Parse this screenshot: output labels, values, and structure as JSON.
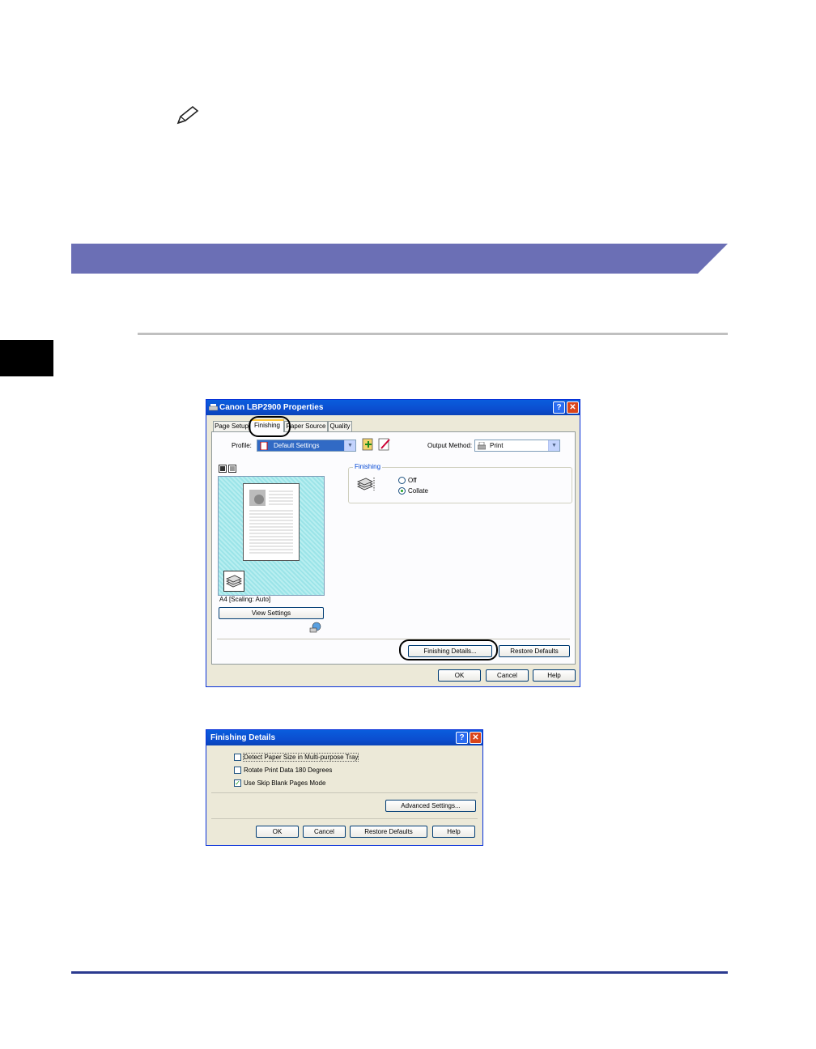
{
  "colors": {
    "banner": "#6b6fb5",
    "footer_rule": "#2b3a8f",
    "dialog_face": "#ece9d8",
    "titlebar": "#0b4ed0",
    "preview_bg": "#9be4e8"
  },
  "icons": [
    "pencil-note-icon",
    "printer-icon",
    "profile-icon",
    "finishing-stack-icon",
    "view-options-icon"
  ],
  "properties_dialog": {
    "title": "Canon LBP2900 Properties",
    "help_btn": "?",
    "close_btn": "✕",
    "tabs": [
      "Page Setup",
      "Finishing",
      "Paper Source",
      "Quality"
    ],
    "active_tab": "Finishing",
    "profile_label": "Profile:",
    "profile_value": "Default Settings",
    "output_method_label": "Output Method:",
    "output_method_value": "Print",
    "preview_caption": "A4 [Scaling: Auto]",
    "view_settings_btn": "View Settings",
    "finishing_group": "Finishing",
    "finishing_options": [
      "Off",
      "Collate"
    ],
    "finishing_selected": "Collate",
    "finishing_details_btn": "Finishing Details...",
    "restore_defaults_btn": "Restore Defaults",
    "ok_btn": "OK",
    "cancel_btn": "Cancel",
    "help_label": "Help"
  },
  "finishing_details_dialog": {
    "title": "Finishing Details",
    "help_btn": "?",
    "close_btn": "✕",
    "options": [
      {
        "label": "Detect Paper Size in Multi-purpose Tray",
        "checked": false
      },
      {
        "label": "Rotate Print Data 180 Degrees",
        "checked": false
      },
      {
        "label": "Use Skip Blank Pages Mode",
        "checked": true
      }
    ],
    "advanced_btn": "Advanced Settings...",
    "ok_btn": "OK",
    "cancel_btn": "Cancel",
    "restore_defaults_btn": "Restore Defaults",
    "help_label": "Help"
  }
}
